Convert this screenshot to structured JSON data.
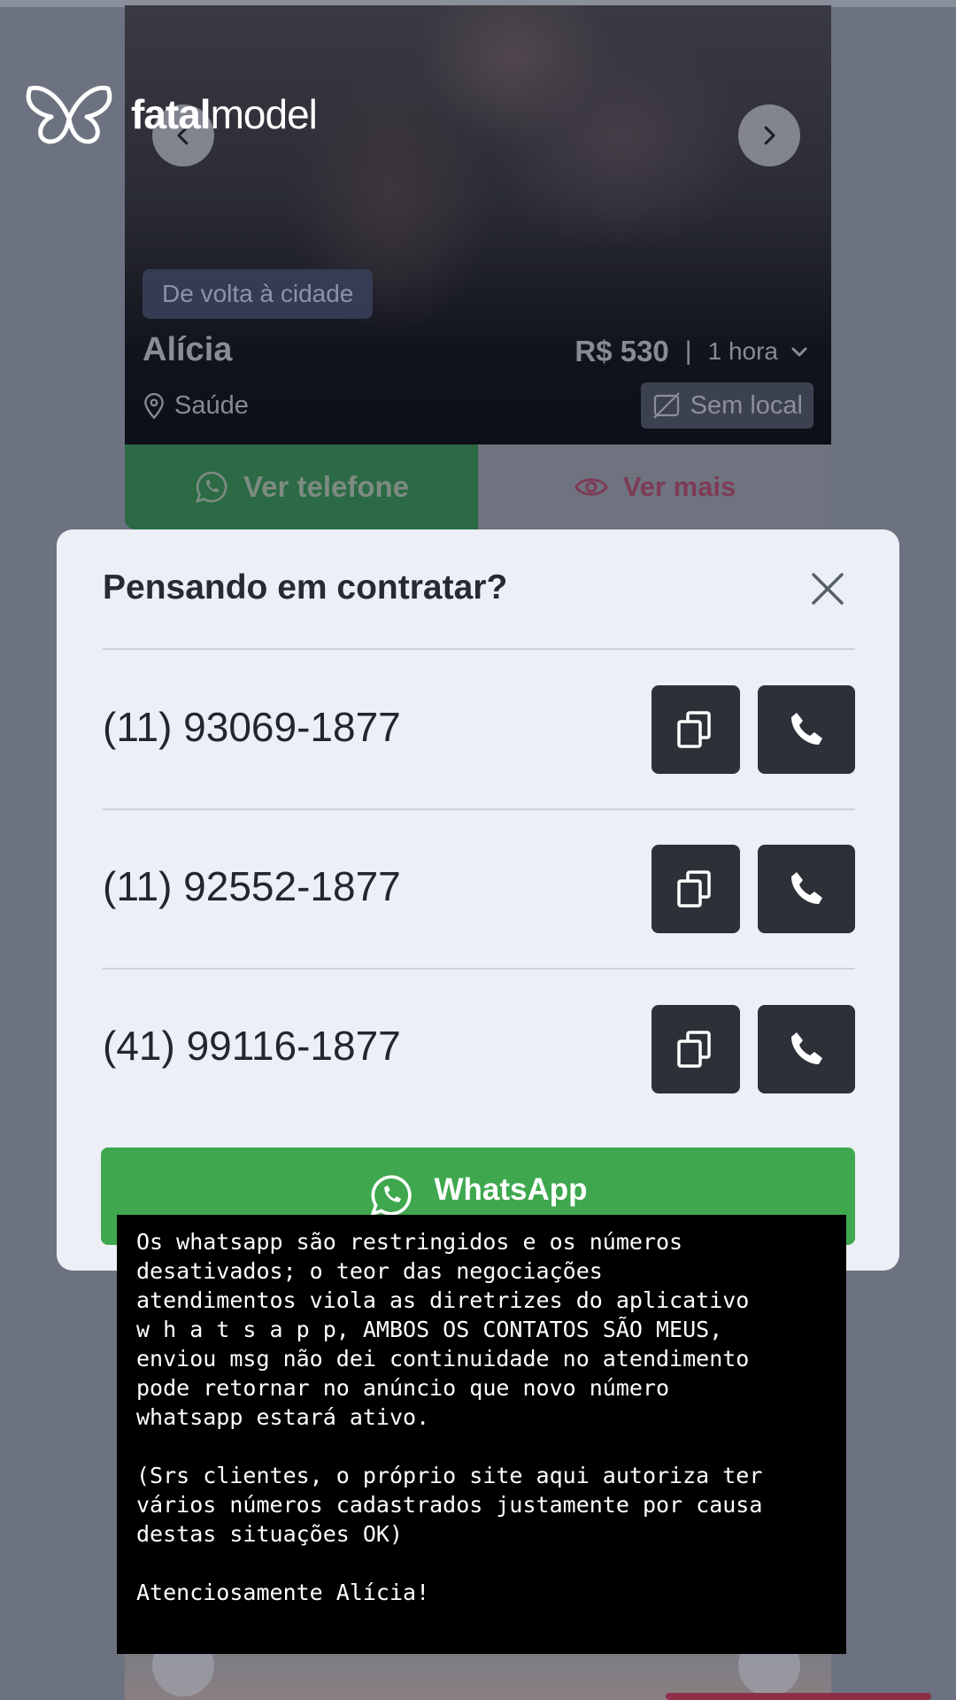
{
  "brand": {
    "name_bold": "fatal",
    "name_rest": "model",
    "logo_icon": "butterfly-logo-icon"
  },
  "listing": {
    "badge": "De volta à cidade",
    "name": "Alícia",
    "price": "R$ 530",
    "separator": "|",
    "duration": "1 hora",
    "location": "Saúde",
    "no_place": "Sem local",
    "phone_button": "Ver telefone",
    "more_button": "Ver mais"
  },
  "modal": {
    "title": "Pensando em contratar?",
    "phones": [
      {
        "number": "(11) 93069-1877"
      },
      {
        "number": "(11) 92552-1877"
      },
      {
        "number": "(41) 99116-1877"
      }
    ],
    "whatsapp_label": "WhatsApp"
  },
  "note": {
    "text": "Os whatsapp são restringidos e os números\ndesativados; o teor das negociações\natendimentos viola as diretrizes do aplicativo\nw h a t s a p p, AMBOS OS CONTATOS SÃO MEUS,\nenviou msg não dei continuidade no atendimento\npode retornar no anúncio que novo número\nwhatsapp estará ativo.\n\n(Srs clientes, o próprio site aqui autoriza ter\nvários números cadastrados justamente por causa\ndestas situações OK)\n\nAtenciosamente Alícia!"
  },
  "colors": {
    "whatsapp_green": "#3fa84e",
    "phone_green": "#2b6a44",
    "accent_pink": "#7e3b54",
    "modal_bg": "#eceff5"
  }
}
